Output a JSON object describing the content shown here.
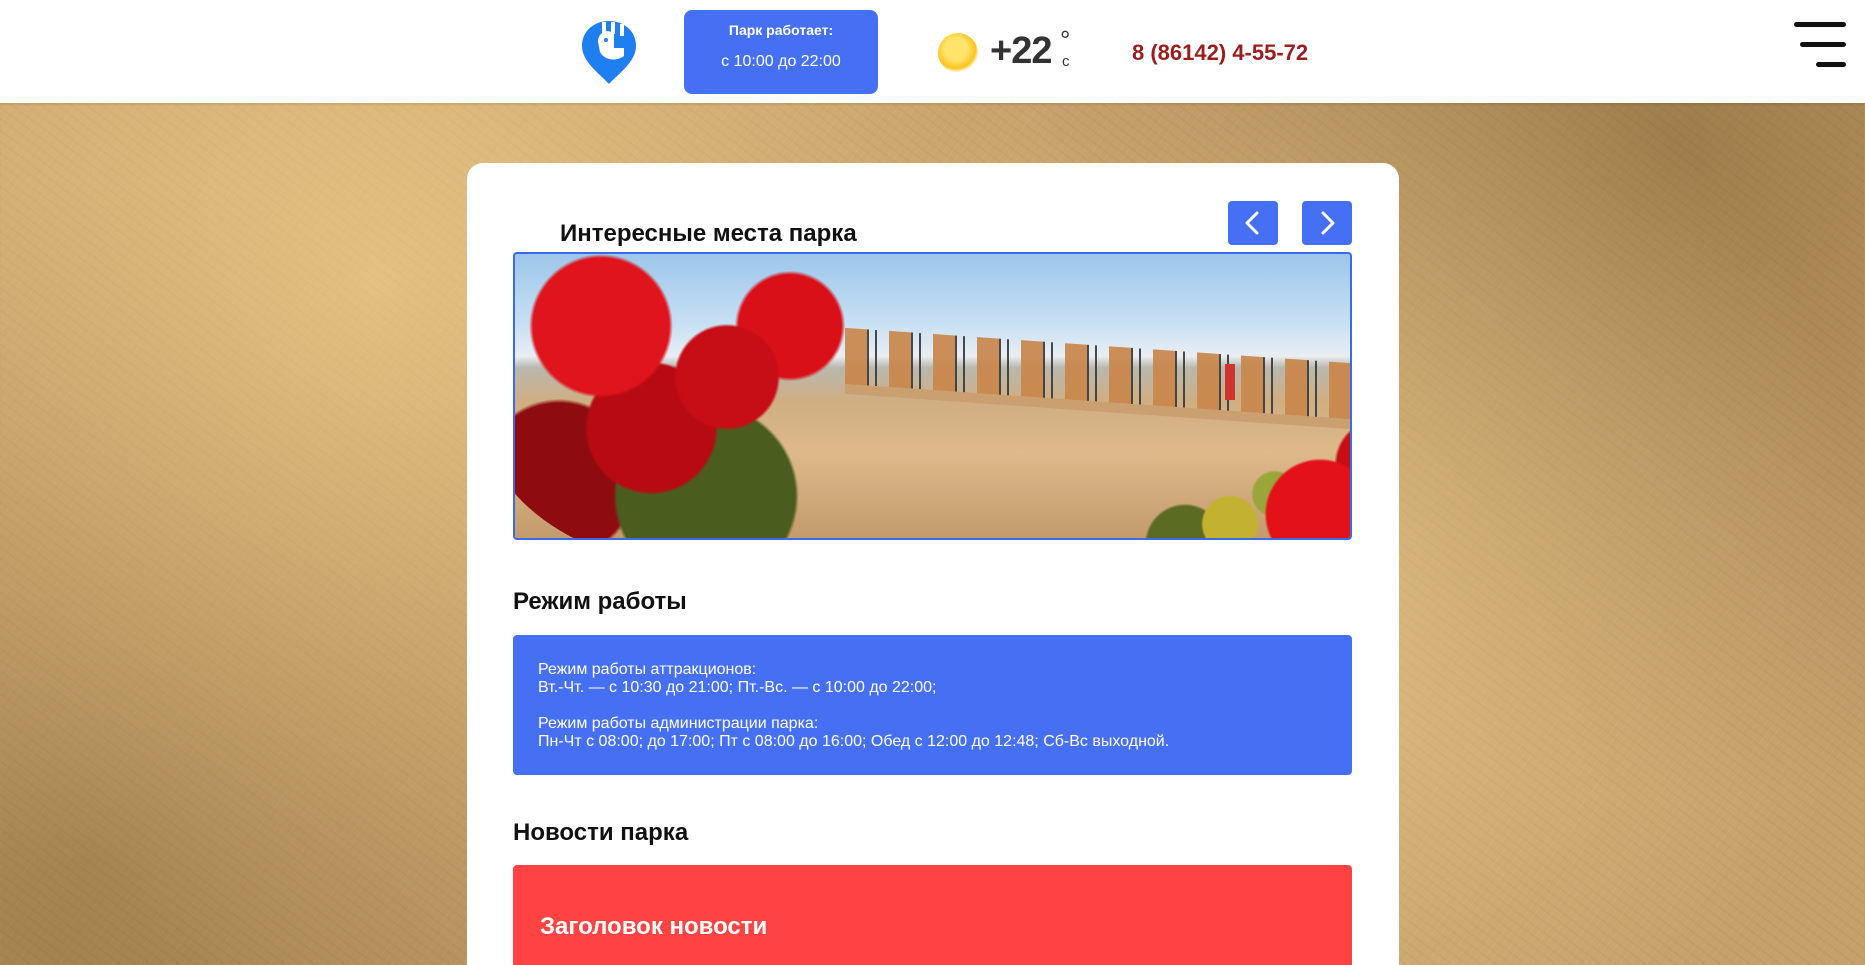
{
  "header": {
    "hours_label": "Парк работает:",
    "hours_value": "с 10:00 до 22:00",
    "temperature": "+22",
    "degree_symbol": "°",
    "degree_unit": "c",
    "phone": "8 (86142) 4-55-72"
  },
  "slider": {
    "title": "Интересные места парка"
  },
  "schedule": {
    "title": "Режим работы",
    "attractions_label": "Режим работы аттракционов:",
    "attractions_hours": "Вт.-Чт. — с 10:30 до 21:00; Пт.-Вс. — с 10:00 до 22:00;",
    "admin_label": "Режим работы администрации парка:",
    "admin_hours": "Пн-Чт с 08:00; до 17:00; Пт с 08:00 до 16:00; Обед с 12:00 до 12:48; Сб-Вс выходной."
  },
  "news": {
    "title": "Новости парка",
    "item_heading": "Заголовок новости"
  },
  "colors": {
    "accent_blue": "#4670f4",
    "news_red": "#ff4242",
    "phone_red": "#9b1d1d"
  },
  "icons": [
    "park-logo-icon",
    "sun-icon",
    "menu-burger-icon",
    "chevron-left-icon",
    "chevron-right-icon"
  ]
}
